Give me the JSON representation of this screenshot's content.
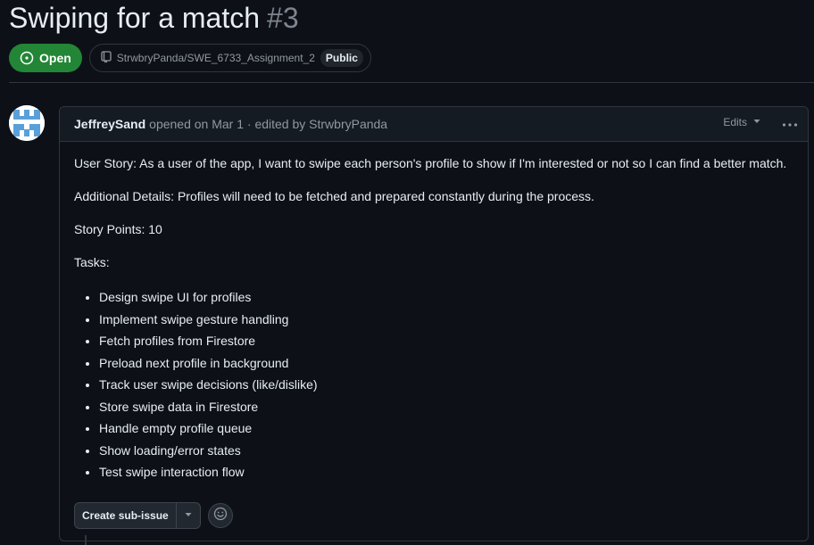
{
  "issue": {
    "title": "Swiping for a match",
    "number": "#3",
    "state": "Open",
    "repo": "StrwbryPanda/SWE_6733_Assignment_2",
    "visibility": "Public"
  },
  "comment": {
    "author": "JeffreySand",
    "meta": "opened on Mar 1 · edited by StrwbryPanda",
    "edits_label": "Edits",
    "paragraphs": [
      "User Story: As a user of the app, I want to swipe each person's profile to show if I'm interested or not so I can find a better match.",
      "Additional Details: Profiles will need to be fetched and prepared constantly during the process.",
      "Story Points: 10",
      "Tasks:"
    ],
    "tasks": [
      "Design swipe UI for profiles",
      "Implement swipe gesture handling",
      "Fetch profiles from Firestore",
      "Preload next profile in background",
      "Track user swipe decisions (like/dislike)",
      "Store swipe data in Firestore",
      "Handle empty profile queue",
      "Show loading/error states",
      "Test swipe interaction flow"
    ],
    "create_sub_issue_label": "Create sub-issue"
  },
  "icons": {
    "state": "issue-opened-icon",
    "repo": "repo-icon",
    "caret": "triangle-down-icon",
    "kebab": "kebab-horizontal-icon",
    "emoji": "smiley-icon"
  },
  "colors": {
    "background": "#0d1117",
    "open_green": "#238636",
    "border": "#30363d",
    "muted_text": "#9198a1"
  }
}
